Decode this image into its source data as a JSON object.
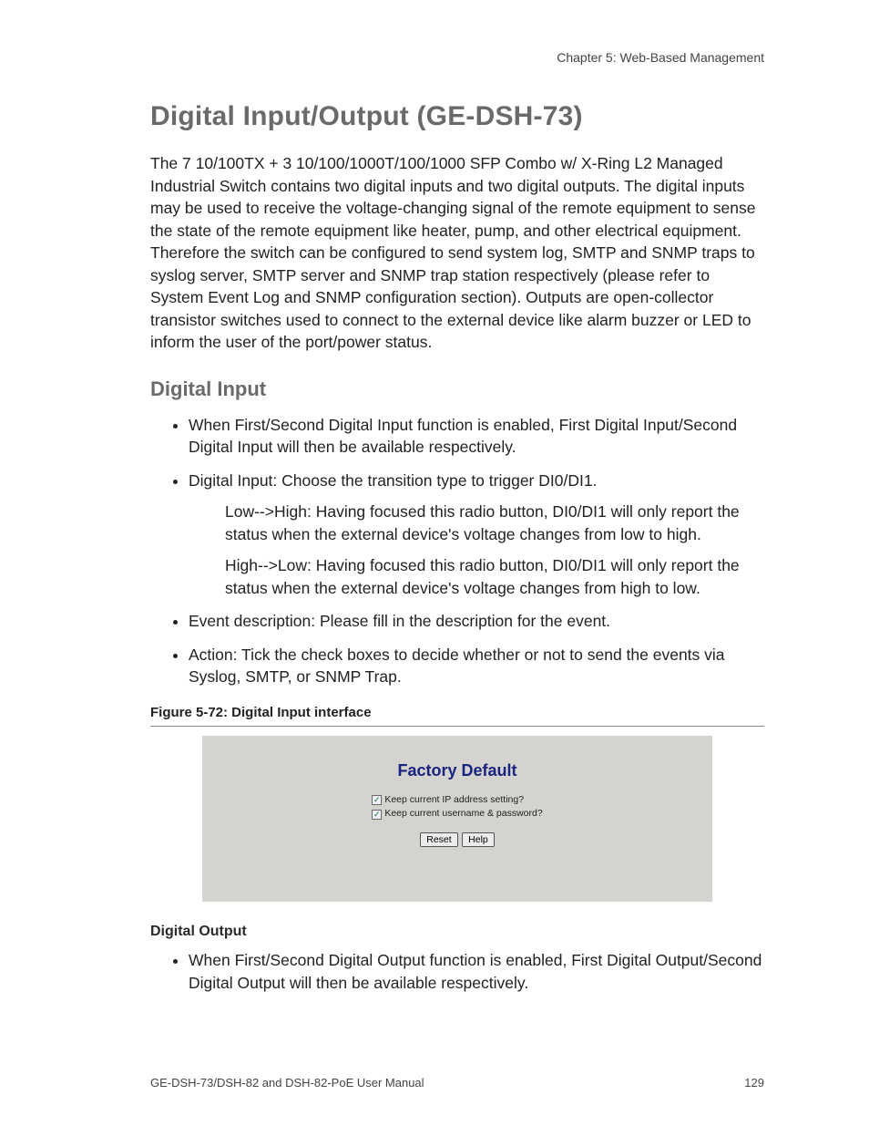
{
  "chapter_line": "Chapter 5: Web-Based Management",
  "section_title": "Digital Input/Output (GE-DSH-73)",
  "intro_paragraph": "The 7 10/100TX + 3 10/100/1000T/100/1000 SFP Combo w/ X-Ring L2 Managed Industrial Switch contains two digital inputs and two digital outputs. The digital inputs may be used to receive the voltage-changing signal of the remote equipment to sense the state of the remote equipment like heater, pump, and other electrical equipment. Therefore the switch can be configured to send system log, SMTP and SNMP traps to syslog server, SMTP server and SNMP trap station respectively (please refer to System Event Log and SNMP configuration section). Outputs are open-collector transistor switches used to connect to the external device like alarm buzzer or LED to inform the user of the port/power status.",
  "digital_input_heading": "Digital Input",
  "di_bullets": {
    "b1": "When First/Second Digital Input function is enabled, First Digital Input/Second Digital Input will then be available respectively.",
    "b2": "Digital Input: Choose the transition type to trigger DI0/DI1.",
    "b2_sub1": "Low-->High: Having focused this radio button, DI0/DI1 will only report the status when the external device's voltage changes from low to high.",
    "b2_sub2": "High-->Low: Having focused this radio button, DI0/DI1 will only report the status when the external device's voltage changes from high to low.",
    "b3": "Event description: Please fill in the description for the event.",
    "b4": "Action: Tick the check boxes to decide whether or not to send the events via Syslog, SMTP, or SNMP Trap."
  },
  "figure_caption": "Figure 5-72:  Digital Input interface",
  "factory_default": {
    "title": "Factory Default",
    "opt1": "Keep current IP address setting?",
    "opt2": "Keep current username & password?",
    "btn_reset": "Reset",
    "btn_help": "Help"
  },
  "digital_output_heading": "Digital Output",
  "do_bullets": {
    "b1": "When First/Second Digital Output function is enabled, First Digital Output/Second Digital Output will then be available respectively."
  },
  "footer_left": "GE-DSH-73/DSH-82 and DSH-82-PoE User Manual",
  "footer_right": "129"
}
